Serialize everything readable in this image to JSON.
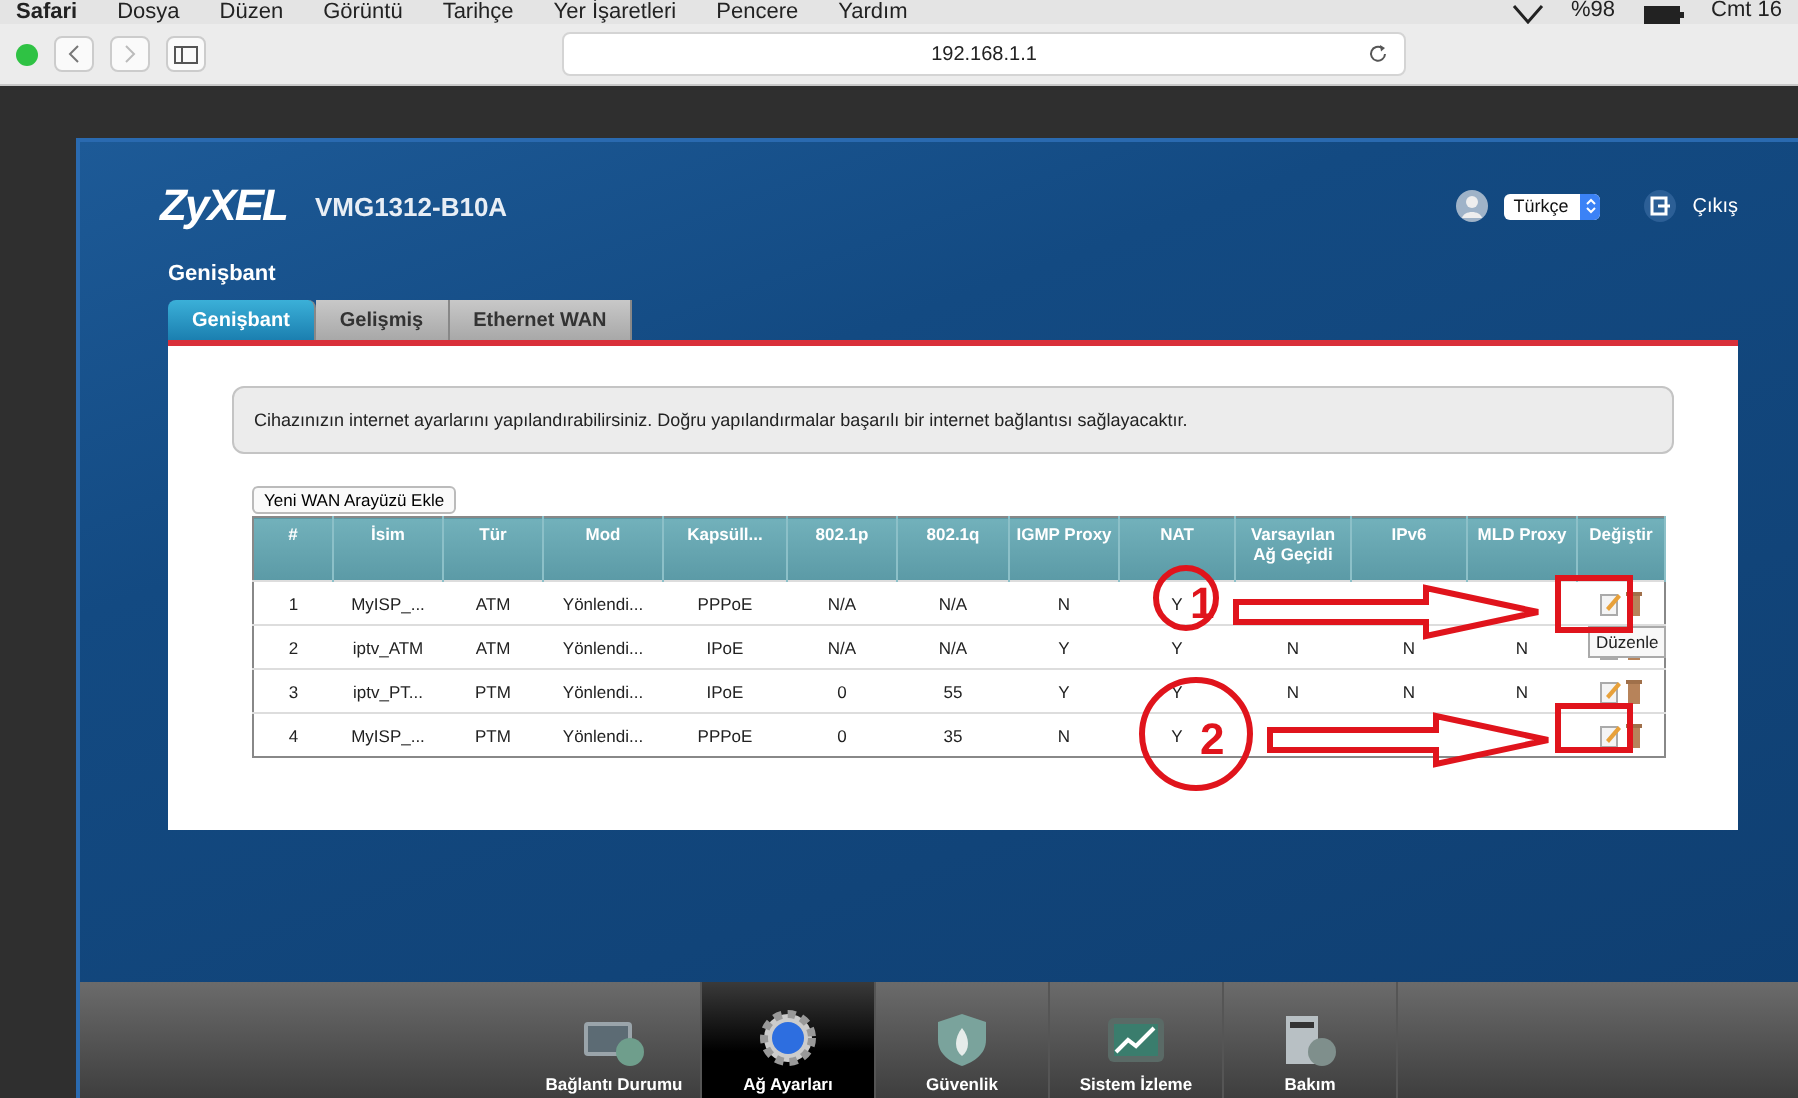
{
  "menubar": {
    "items": [
      "Safari",
      "Dosya",
      "Düzen",
      "Görüntü",
      "Tarihçe",
      "Yer İşaretleri",
      "Pencere",
      "Yardım"
    ],
    "battery": "%98",
    "clock": "Cmt 16"
  },
  "browser": {
    "url": "192.168.1.1"
  },
  "router": {
    "brand": "ZyXEL",
    "model": "VMG1312-B10A",
    "language": "Türkçe",
    "logout": "Çıkış",
    "section_title": "Genişbant",
    "tabs": [
      {
        "label": "Genişbant",
        "selected": true
      },
      {
        "label": "Gelişmiş",
        "selected": false
      },
      {
        "label": "Ethernet WAN",
        "selected": false
      }
    ],
    "info": "Cihazınızın internet ayarlarını yapılandırabilirsiniz. Doğru yapılandırmalar başarılı bir internet bağlantısı sağlayacaktır.",
    "add_button": "Yeni WAN Arayüzü Ekle",
    "table": {
      "columns": [
        "#",
        "İsim",
        "Tür",
        "Mod",
        "Kapsüll...",
        "802.1p",
        "802.1q",
        "IGMP Proxy",
        "NAT",
        "Varsayılan Ağ Geçidi",
        "IPv6",
        "MLD Proxy",
        "Değiştir"
      ],
      "rows": [
        {
          "cells": [
            "1",
            "MyISP_...",
            "ATM",
            "Yönlendi...",
            "PPPoE",
            "N/A",
            "N/A",
            "N",
            "Y",
            null,
            null,
            null
          ]
        },
        {
          "cells": [
            "2",
            "iptv_ATM",
            "ATM",
            "Yönlendi...",
            "IPoE",
            "N/A",
            "N/A",
            "Y",
            "Y",
            "N",
            "N",
            "N"
          ]
        },
        {
          "cells": [
            "3",
            "iptv_PT...",
            "PTM",
            "Yönlendi...",
            "IPoE",
            "0",
            "55",
            "Y",
            "Y",
            "N",
            "N",
            "N"
          ]
        },
        {
          "cells": [
            "4",
            "MyISP_...",
            "PTM",
            "Yönlendi...",
            "PPPoE",
            "0",
            "35",
            "N",
            "Y",
            null,
            null,
            null
          ]
        }
      ]
    },
    "tooltip": "Düzenle",
    "annotations": [
      {
        "label": "1"
      },
      {
        "label": "2"
      }
    ],
    "nav": [
      {
        "label": "Bağlantı Durumu",
        "selected": false
      },
      {
        "label": "Ağ Ayarları",
        "selected": true
      },
      {
        "label": "Güvenlik",
        "selected": false
      },
      {
        "label": "Sistem İzleme",
        "selected": false
      },
      {
        "label": "Bakım",
        "selected": false
      }
    ]
  }
}
